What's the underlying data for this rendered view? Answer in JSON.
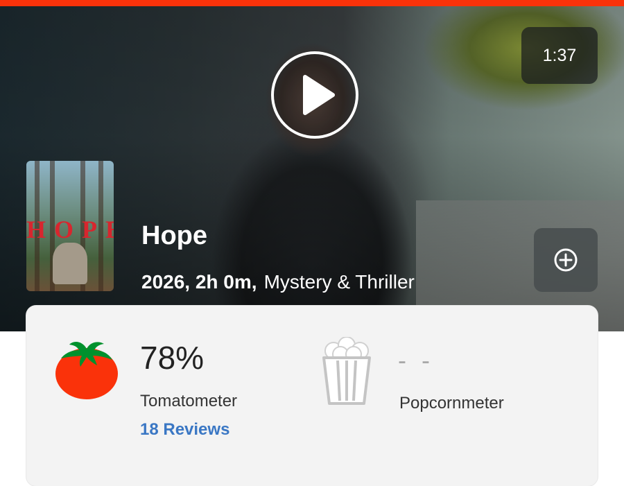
{
  "player": {
    "duration": "1:37"
  },
  "movie": {
    "title": "Hope",
    "year_length": "2026, 2h 0m,",
    "genre": "Mystery & Thriller",
    "poster_title": "HOPE"
  },
  "scores": {
    "tomatometer": {
      "value": "78%",
      "label": "Tomatometer",
      "reviews": "18 Reviews"
    },
    "popcornmeter": {
      "value": "- -",
      "label": "Popcornmeter"
    }
  },
  "colors": {
    "brand_red": "#fa320a",
    "link_blue": "#3a77c4",
    "tomato_red": "#fa320a",
    "leaf_green": "#00912d"
  }
}
